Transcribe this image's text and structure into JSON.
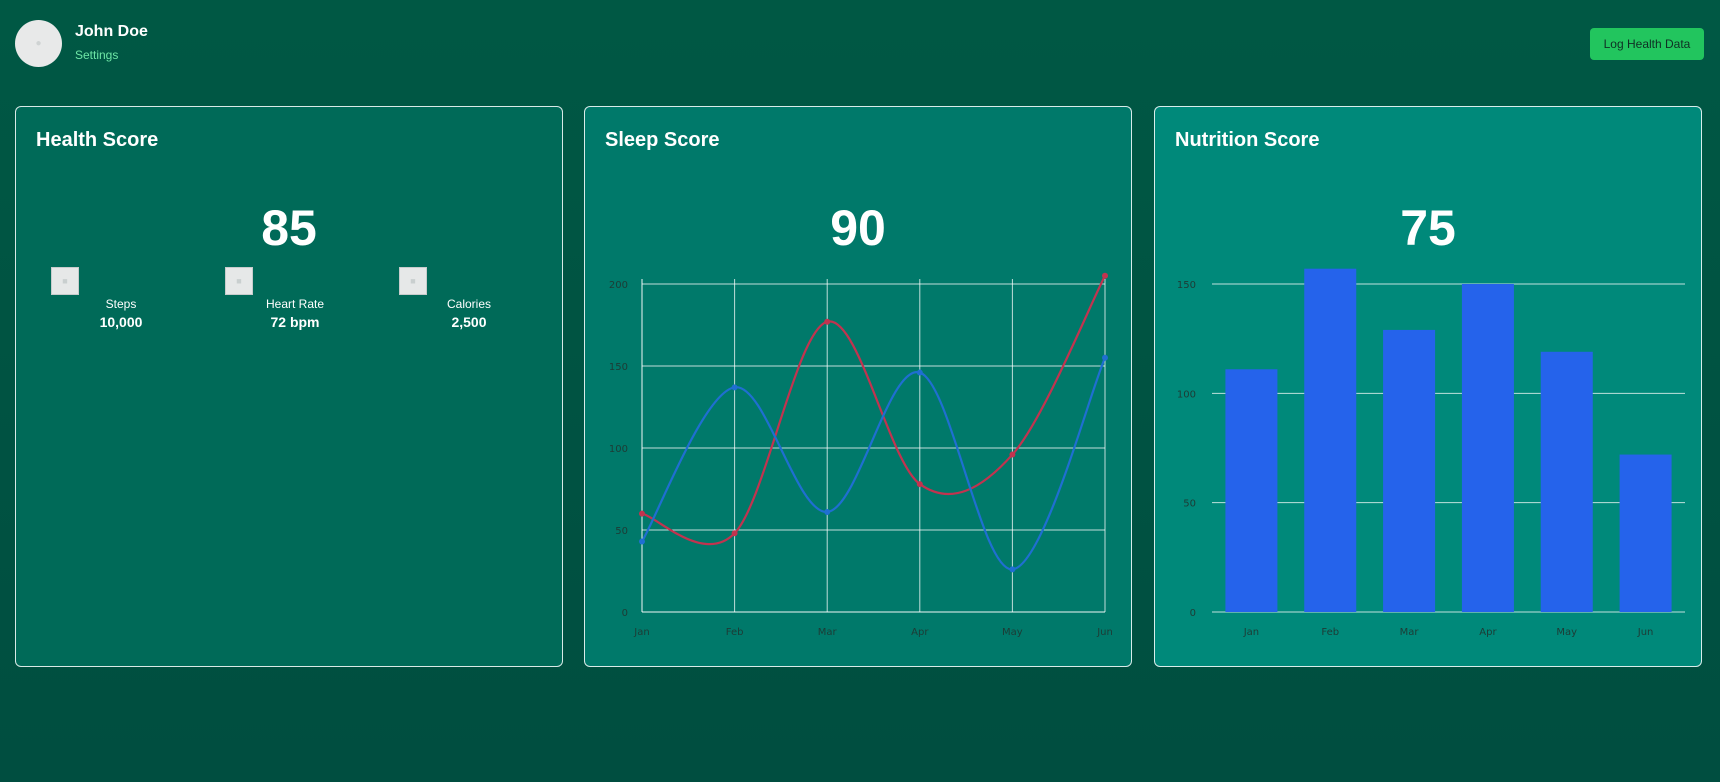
{
  "user": {
    "name": "John Doe",
    "settings_label": "Settings",
    "avatar_icon": "user-avatar-placeholder"
  },
  "header": {
    "log_button_label": "Log Health Data"
  },
  "colors": {
    "accent_green": "#22c55e",
    "line_red": "#c2334f",
    "line_blue": "#1f6fd1",
    "bar_blue": "#2563eb"
  },
  "cards": {
    "health": {
      "title": "Health Score",
      "score": "85",
      "stats": [
        {
          "icon": "steps-icon",
          "label": "Steps",
          "value": "10,000"
        },
        {
          "icon": "heart-icon",
          "label": "Heart Rate",
          "value": "72 bpm"
        },
        {
          "icon": "calories-icon",
          "label": "Calories",
          "value": "2,500"
        }
      ]
    },
    "sleep": {
      "title": "Sleep Score",
      "score": "90"
    },
    "nutrition": {
      "title": "Nutrition Score",
      "score": "75"
    }
  },
  "chart_data": [
    {
      "type": "line",
      "title": "",
      "categories": [
        "Jan",
        "Feb",
        "Mar",
        "Apr",
        "May",
        "Jun"
      ],
      "ylim": [
        0,
        200
      ],
      "yticks": [
        0,
        50,
        100,
        150,
        200
      ],
      "grid": true,
      "series": [
        {
          "color": "#c2334f",
          "values": [
            60,
            48,
            177,
            78,
            96,
            205
          ]
        },
        {
          "color": "#1f6fd1",
          "values": [
            43,
            137,
            61,
            146,
            26,
            155
          ]
        }
      ]
    },
    {
      "type": "bar",
      "title": "",
      "categories": [
        "Jan",
        "Feb",
        "Mar",
        "Apr",
        "May",
        "Jun"
      ],
      "ylim": [
        0,
        150
      ],
      "yticks": [
        0,
        50,
        100,
        150
      ],
      "grid": true,
      "series": [
        {
          "color": "#2563eb",
          "values": [
            111,
            157,
            129,
            150,
            119,
            72
          ]
        }
      ]
    }
  ]
}
